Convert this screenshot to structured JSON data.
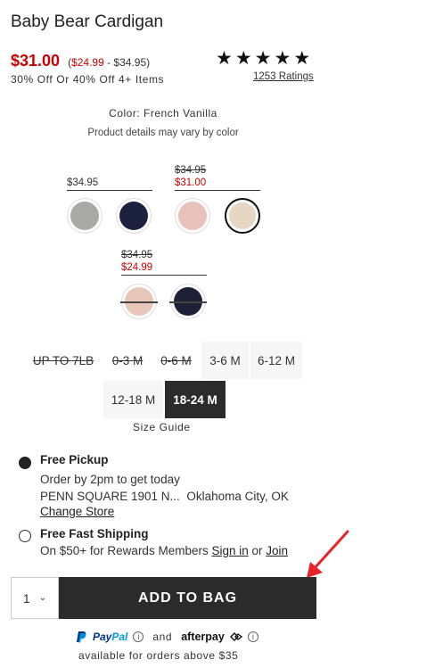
{
  "product": {
    "title": "Baby Bear Cardigan",
    "price": "$31.00",
    "price_range_open": "(",
    "price_range_low": "$24.99",
    "price_range_rest": " - $34.95)",
    "offer": "30% Off Or 40% Off 4+ Items",
    "rating_stars": 5,
    "ratings_link": "1253 Ratings"
  },
  "color": {
    "label": "Color: French Vanilla",
    "note": "Product details may vary by color",
    "groups": [
      {
        "price": "$34.95",
        "sale": ""
      },
      {
        "price": "$34.95",
        "sale": "$31.00"
      },
      {
        "price": "$34.95",
        "sale": "$24.99"
      }
    ],
    "swatches": [
      {
        "name": "gray",
        "color": "#a9aaa5",
        "selected": false
      },
      {
        "name": "navy",
        "color": "#1c2140",
        "selected": false
      },
      {
        "name": "pink",
        "color": "#e8c1ba",
        "selected": false
      },
      {
        "name": "french-vanilla",
        "color": "#e5d7c2",
        "selected": true
      },
      {
        "name": "peach-pattern",
        "color": "#e8c6b8",
        "selected": false
      },
      {
        "name": "navy-stripe",
        "color": "#1e2038",
        "selected": false
      }
    ]
  },
  "sizes": [
    {
      "label": "UP TO 7LB",
      "state": "disabled"
    },
    {
      "label": "0-3 M",
      "state": "disabled"
    },
    {
      "label": "0-6 M",
      "state": "disabled"
    },
    {
      "label": "3-6 M",
      "state": "available"
    },
    {
      "label": "6-12 M",
      "state": "available"
    },
    {
      "label": "12-18 M",
      "state": "available"
    },
    {
      "label": "18-24 M",
      "state": "selected"
    }
  ],
  "size_guide": "Size Guide",
  "fulfillment": {
    "pickup": {
      "title": "Free Pickup",
      "line1": "Order by 2pm to get today",
      "store": "PENN SQUARE 1901 N...",
      "city": "Oklahoma City, OK",
      "change_link": "Change Store"
    },
    "shipping": {
      "title": "Free Fast Shipping",
      "text_before": "On $50+ for Rewards Members ",
      "sign_in": "Sign in",
      "or": " or ",
      "join": "Join"
    }
  },
  "cart": {
    "quantity": "1",
    "add_label": "ADD TO BAG"
  },
  "payment": {
    "paypal_a": "Pay",
    "paypal_b": "Pal",
    "and": "and",
    "afterpay": "afterpay",
    "note": "available for orders above $35"
  },
  "colors": {
    "sale_red": "#cc0000",
    "annotation_arrow": "#e8232a",
    "button_dark": "#2b2b2b"
  }
}
